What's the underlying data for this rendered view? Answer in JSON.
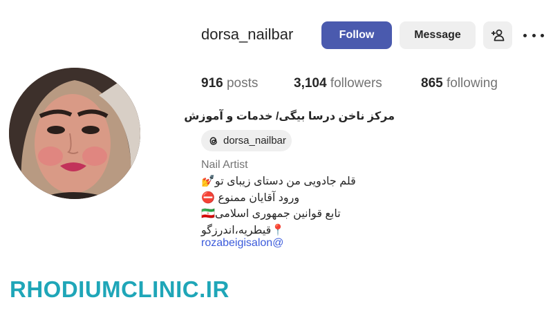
{
  "profile": {
    "username": "dorsa_nailbar",
    "follow_label": "Follow",
    "message_label": "Message"
  },
  "stats": {
    "posts_count": "916",
    "posts_label": "posts",
    "followers_count": "3,104",
    "followers_label": "followers",
    "following_count": "865",
    "following_label": "following"
  },
  "bio": {
    "full_name": "مرکز ناخن درسا بیگی/ خدمات و آموزش",
    "threads_handle": "dorsa_nailbar",
    "category": "Nail Artist",
    "lines": [
      "قلم جادویی من دستای زیبای تو💅",
      "ورود آقایان ممنوع ⛔",
      "تابع قوانین جمهوری اسلامی🇮🇷",
      "📍قیطریه،اندرزگو"
    ],
    "link": "rozabeigisalon@"
  },
  "watermark": "RHODIUMCLINIC.IR",
  "colors": {
    "follow_button": "#4a5aae",
    "secondary_button": "#efefef",
    "link": "#3b5bdb",
    "watermark": "#1fa6b8",
    "muted_text": "#737373"
  },
  "icons": {
    "add_user": "add-user-icon",
    "more": "more-options-icon",
    "threads": "threads-icon"
  }
}
